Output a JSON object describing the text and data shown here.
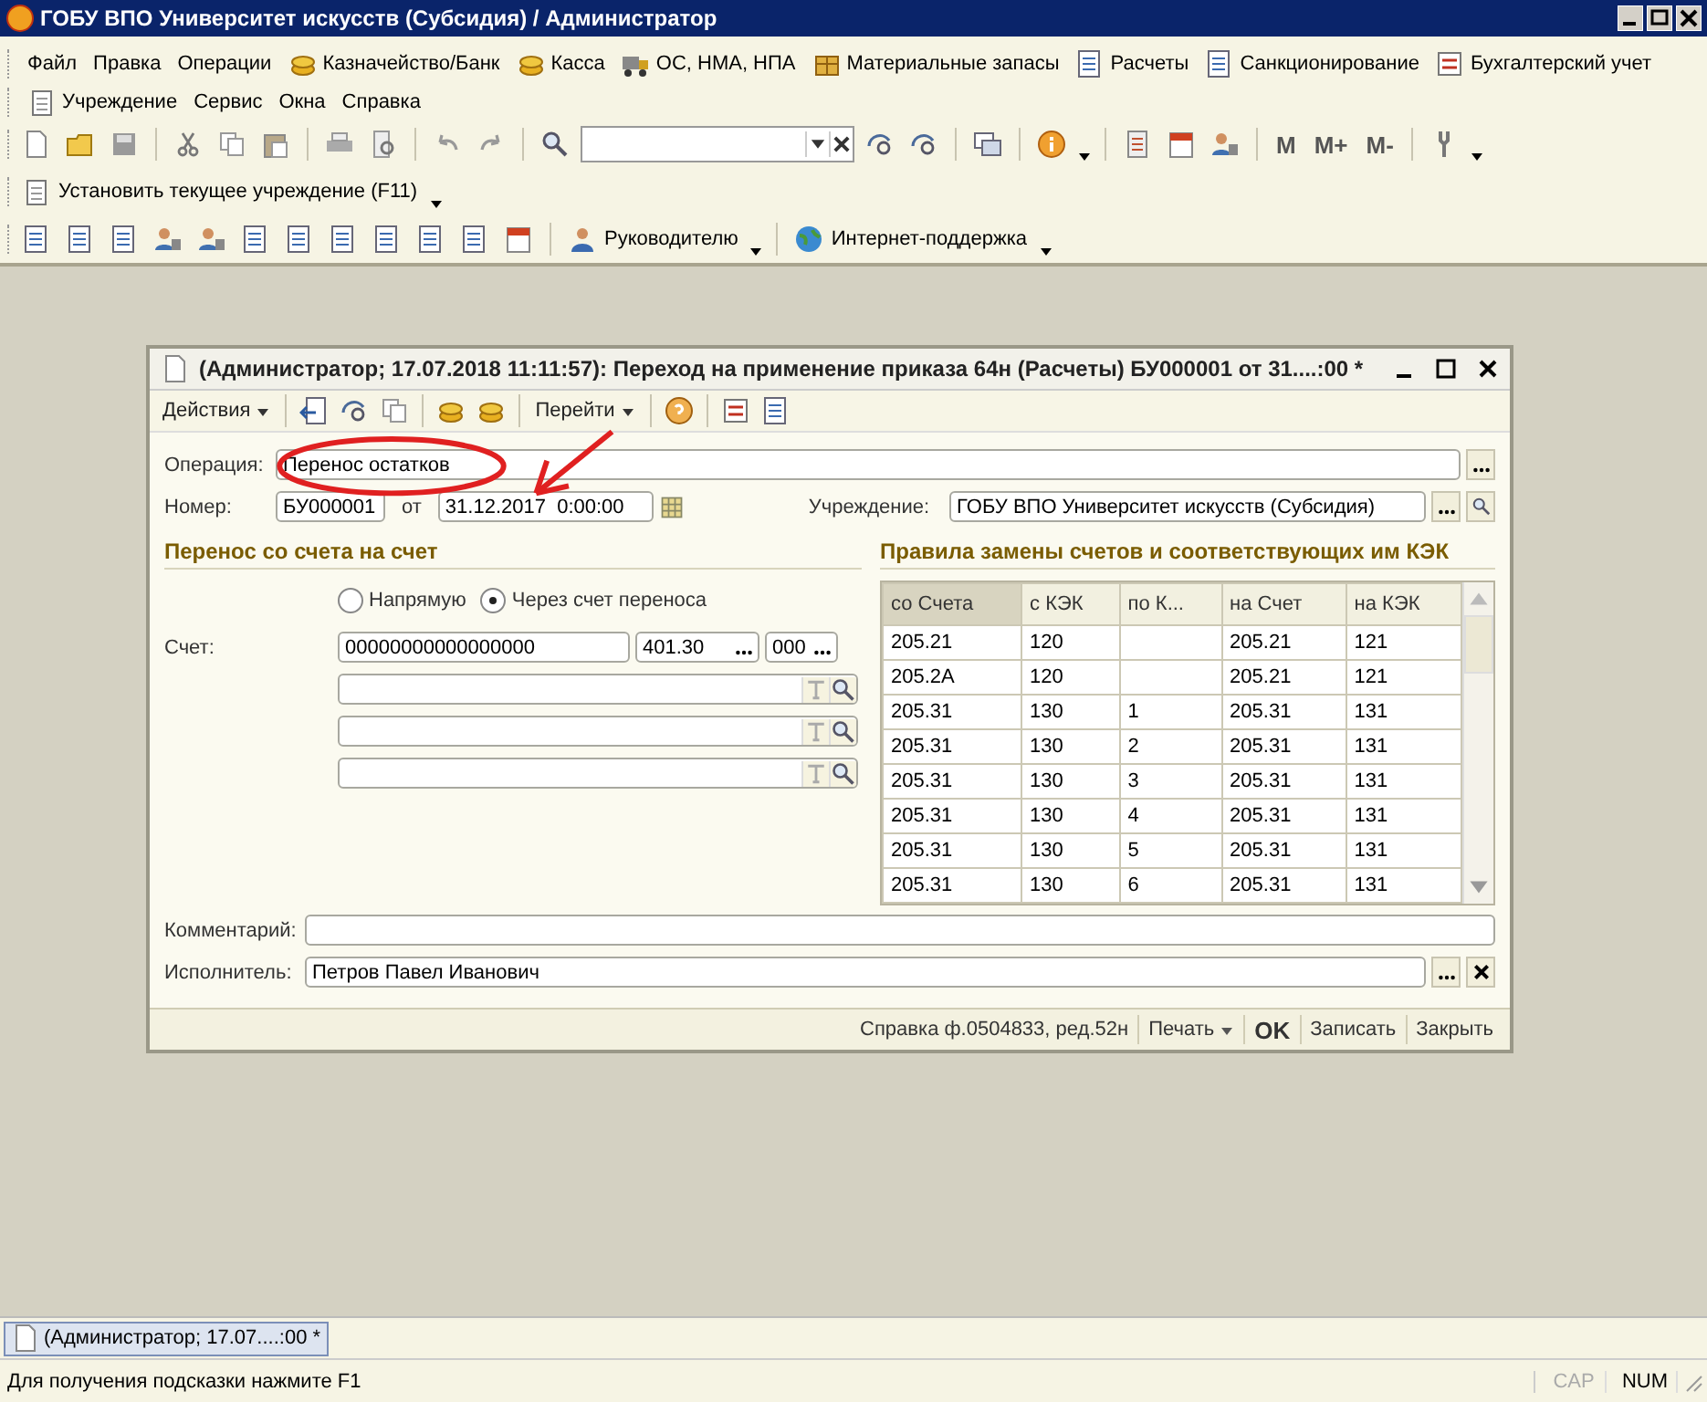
{
  "window": {
    "title": "ГОБУ ВПО Университет искусств (Субсидия) / Администратор"
  },
  "menu_rows": [
    [
      {
        "label": "Файл",
        "kind": "plain"
      },
      {
        "label": "Правка",
        "kind": "plain"
      },
      {
        "label": "Операции",
        "kind": "plain"
      },
      {
        "label": "Казначейство/Банк",
        "kind": "icon"
      },
      {
        "label": "Касса",
        "kind": "icon"
      },
      {
        "label": "ОС, НМА, НПА",
        "kind": "icon"
      },
      {
        "label": "Материальные запасы",
        "kind": "icon"
      },
      {
        "label": "Расчеты",
        "kind": "icon"
      },
      {
        "label": "Санкционирование",
        "kind": "icon"
      },
      {
        "label": "Бухгалтерский учет",
        "kind": "icon"
      }
    ],
    [
      {
        "label": "Учреждение",
        "kind": "icon"
      },
      {
        "label": "Сервис",
        "kind": "plain"
      },
      {
        "label": "Окна",
        "kind": "plain"
      },
      {
        "label": "Справка",
        "kind": "plain"
      }
    ]
  ],
  "memory_buttons": [
    "M",
    "M+",
    "M-"
  ],
  "institution_button": "Установить текущее учреждение (F11)",
  "toolbar_buttons": [
    "Руководителю",
    "Интернет-поддержка"
  ],
  "dialog": {
    "title": "(Администратор; 17.07.2018 11:11:57): Переход на применение приказа 64н (Расчеты) БУ000001 от 31....:00 *",
    "toolbar": [
      "Действия",
      "Перейти"
    ],
    "operation_label": "Операция:",
    "operation": "Перенос остатков",
    "number_label": "Номер:",
    "number": "БУ000001",
    "date_label": "от",
    "date": "31.12.2017  0:00:00",
    "institution_label": "Учреждение:",
    "institution": "ГОБУ ВПО Университет искусств (Субсидия)",
    "transfer": {
      "heading": "Перенос со счета на счет",
      "options": [
        {
          "label": "Напрямую",
          "selected": false
        },
        {
          "label": "Через счет переноса",
          "selected": true
        }
      ],
      "account_label": "Счет:",
      "account": "00000000000000000",
      "account_code": "401.30",
      "kek": "000"
    },
    "rules": {
      "heading": "Правила замены счетов и соответствующих им КЭК",
      "columns": [
        "со Счета",
        "с КЭК",
        "по К...",
        "на Счет",
        "на КЭК"
      ],
      "rows": [
        [
          "205.21",
          "120",
          "",
          "205.21",
          "121"
        ],
        [
          "205.2А",
          "120",
          "",
          "205.21",
          "121"
        ],
        [
          "205.31",
          "130",
          "1",
          "205.31",
          "131"
        ],
        [
          "205.31",
          "130",
          "2",
          "205.31",
          "131"
        ],
        [
          "205.31",
          "130",
          "3",
          "205.31",
          "131"
        ],
        [
          "205.31",
          "130",
          "4",
          "205.31",
          "131"
        ],
        [
          "205.31",
          "130",
          "5",
          "205.31",
          "131"
        ],
        [
          "205.31",
          "130",
          "6",
          "205.31",
          "131"
        ]
      ]
    },
    "comment_label": "Комментарий:",
    "executor_label": "Исполнитель:",
    "executor": "Петров Павел Иванович",
    "footer": [
      {
        "label": "Справка ф.0504833, ред.52н",
        "kind": "button"
      },
      {
        "label": "Печать",
        "kind": "menu"
      },
      {
        "label": "OK",
        "kind": "default"
      },
      {
        "label": "Записать",
        "kind": "button"
      },
      {
        "label": "Закрыть",
        "kind": "button"
      }
    ]
  },
  "taskbar": [
    {
      "label": "(Администратор; 17.07....:00 *",
      "selected": true
    }
  ],
  "status_bar": {
    "hint": "Для получения подсказки нажмите F1",
    "indicators": [
      {
        "label": "CAP",
        "on": false
      },
      {
        "label": "NUM",
        "on": true
      }
    ]
  }
}
